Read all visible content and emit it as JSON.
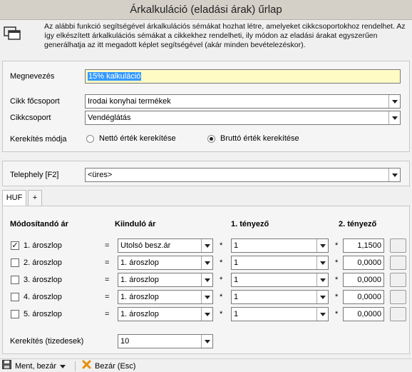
{
  "window": {
    "title": "Árkalkuláció (eladási árak) űrlap"
  },
  "info": {
    "text": "Az alábbi funkció segítségével árkalkulációs sémákat hozhat létre, amelyeket cikkcsoportokhoz rendelhet. Az így elkészített árkalkulációs sémákat a cikkekhez rendelheti, ily módon az eladási árakat egyszerűen generálhatja az itt megadott képlet segítségével (akár minden bevételezéskor)."
  },
  "form": {
    "name_label": "Megnevezés",
    "name_value": "15% kalkuláció",
    "main_group_label": "Cikk főcsoport",
    "main_group_value": "Irodai konyhai termékek",
    "group_label": "Cikkcsoport",
    "group_value": "Vendéglátás",
    "rounding_mode_label": "Kerekítés módja",
    "rounding_net_label": "Nettó érték kerekítése",
    "rounding_gross_label": "Bruttó érték kerekítése",
    "rounding_selected": "gross"
  },
  "site": {
    "label": "Telephely [F2]",
    "value": "<üres>"
  },
  "tabs": [
    {
      "label": "HUF"
    },
    {
      "label": "+"
    }
  ],
  "grid": {
    "headers": {
      "price": "Módosítandó ár",
      "base": "Kiinduló ár",
      "factor1": "1. tényező",
      "factor2": "2. tényező"
    },
    "equals": "=",
    "times": "*",
    "rows": [
      {
        "label": "1. ároszlop",
        "checked": true,
        "base": "Utolsó besz.ár",
        "factor1": "1",
        "factor2": "1,1500"
      },
      {
        "label": "2. ároszlop",
        "checked": false,
        "base": "1. ároszlop",
        "factor1": "1",
        "factor2": "0,0000"
      },
      {
        "label": "3. ároszlop",
        "checked": false,
        "base": "1. ároszlop",
        "factor1": "1",
        "factor2": "0,0000"
      },
      {
        "label": "4. ároszlop",
        "checked": false,
        "base": "1. ároszlop",
        "factor1": "1",
        "factor2": "0,0000"
      },
      {
        "label": "5. ároszlop",
        "checked": false,
        "base": "1. ároszlop",
        "factor1": "1",
        "factor2": "0,0000"
      }
    ],
    "decimals_label": "Kerekítés (tizedesek)",
    "decimals_value": "10"
  },
  "footer": {
    "save_label": "Ment, bezár",
    "close_label": "Bezár (Esc)"
  },
  "colors": {
    "name_field_bg": "#fffbc4",
    "selection": "#3399ff",
    "close_x": "#e8900a"
  }
}
